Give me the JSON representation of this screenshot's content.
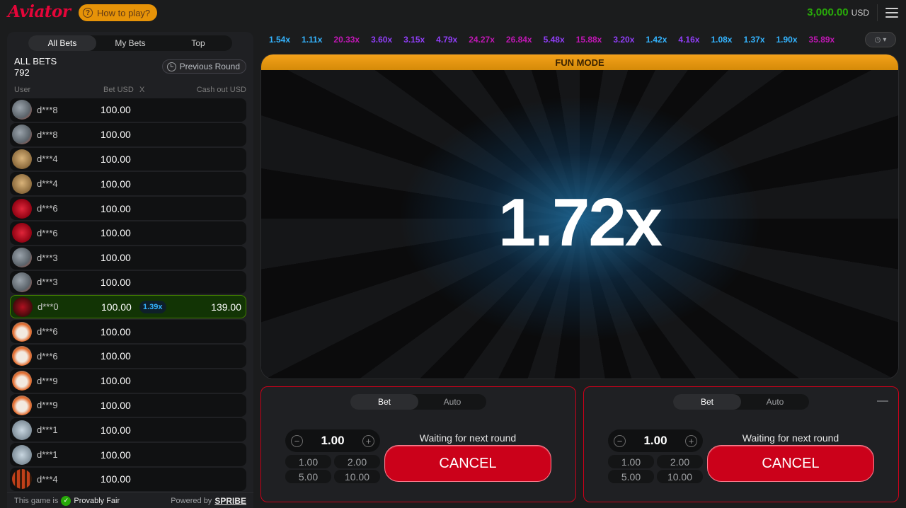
{
  "header": {
    "logo": "Aviator",
    "how_to_play": "How to play?",
    "balance": "3,000.00",
    "currency": "USD"
  },
  "bets_panel": {
    "tabs": [
      "All Bets",
      "My Bets",
      "Top"
    ],
    "active_tab": "All Bets",
    "title": "ALL BETS",
    "count": "792",
    "previous_round": "Previous Round",
    "columns": {
      "user": "User",
      "bet": "Bet USD",
      "x": "X",
      "cashout": "Cash out USD"
    },
    "rows": [
      {
        "user": "d***8",
        "bet": "100.00",
        "mult": "",
        "cashout": "",
        "avatar": "robot",
        "win": false
      },
      {
        "user": "d***8",
        "bet": "100.00",
        "mult": "",
        "cashout": "",
        "avatar": "robot",
        "win": false
      },
      {
        "user": "d***4",
        "bet": "100.00",
        "mult": "",
        "cashout": "",
        "avatar": "lion",
        "win": false
      },
      {
        "user": "d***4",
        "bet": "100.00",
        "mult": "",
        "cashout": "",
        "avatar": "lion",
        "win": false
      },
      {
        "user": "d***6",
        "bet": "100.00",
        "mult": "",
        "cashout": "",
        "avatar": "dice",
        "win": false
      },
      {
        "user": "d***6",
        "bet": "100.00",
        "mult": "",
        "cashout": "",
        "avatar": "dice",
        "win": false
      },
      {
        "user": "d***3",
        "bet": "100.00",
        "mult": "",
        "cashout": "",
        "avatar": "robot",
        "win": false
      },
      {
        "user": "d***3",
        "bet": "100.00",
        "mult": "",
        "cashout": "",
        "avatar": "robot",
        "win": false
      },
      {
        "user": "d***0",
        "bet": "100.00",
        "mult": "1.39x",
        "cashout": "139.00",
        "avatar": "car",
        "win": true
      },
      {
        "user": "d***6",
        "bet": "100.00",
        "mult": "",
        "cashout": "",
        "avatar": "penguin",
        "win": false
      },
      {
        "user": "d***6",
        "bet": "100.00",
        "mult": "",
        "cashout": "",
        "avatar": "penguin",
        "win": false
      },
      {
        "user": "d***9",
        "bet": "100.00",
        "mult": "",
        "cashout": "",
        "avatar": "penguin",
        "win": false
      },
      {
        "user": "d***9",
        "bet": "100.00",
        "mult": "",
        "cashout": "",
        "avatar": "penguin",
        "win": false
      },
      {
        "user": "d***1",
        "bet": "100.00",
        "mult": "",
        "cashout": "",
        "avatar": "money",
        "win": false
      },
      {
        "user": "d***1",
        "bet": "100.00",
        "mult": "",
        "cashout": "",
        "avatar": "money",
        "win": false
      },
      {
        "user": "d***4",
        "bet": "100.00",
        "mult": "",
        "cashout": "",
        "avatar": "flame",
        "win": false
      }
    ],
    "footer": {
      "game_is": "This game is",
      "provably_fair": "Provably Fair",
      "powered_by": "Powered by",
      "brand": "SPRIBE"
    }
  },
  "history": [
    {
      "value": "1.54x",
      "tone": "blue"
    },
    {
      "value": "1.11x",
      "tone": "blue"
    },
    {
      "value": "20.33x",
      "tone": "pink"
    },
    {
      "value": "3.60x",
      "tone": "purple"
    },
    {
      "value": "3.15x",
      "tone": "purple"
    },
    {
      "value": "4.79x",
      "tone": "purple"
    },
    {
      "value": "24.27x",
      "tone": "pink"
    },
    {
      "value": "26.84x",
      "tone": "pink"
    },
    {
      "value": "5.48x",
      "tone": "purple"
    },
    {
      "value": "15.88x",
      "tone": "pink"
    },
    {
      "value": "3.20x",
      "tone": "purple"
    },
    {
      "value": "1.42x",
      "tone": "blue"
    },
    {
      "value": "4.16x",
      "tone": "purple"
    },
    {
      "value": "1.08x",
      "tone": "blue"
    },
    {
      "value": "1.37x",
      "tone": "blue"
    },
    {
      "value": "1.90x",
      "tone": "blue"
    },
    {
      "value": "35.89x",
      "tone": "pink"
    }
  ],
  "game": {
    "mode_banner": "FUN MODE",
    "multiplier": "1.72x"
  },
  "bet_panels": [
    {
      "tabs": [
        "Bet",
        "Auto"
      ],
      "amount": "1.00",
      "quick": [
        "1.00",
        "2.00",
        "5.00",
        "10.00"
      ],
      "status": "Waiting for next round",
      "action": "CANCEL"
    },
    {
      "tabs": [
        "Bet",
        "Auto"
      ],
      "amount": "1.00",
      "quick": [
        "1.00",
        "2.00",
        "5.00",
        "10.00"
      ],
      "status": "Waiting for next round",
      "action": "CANCEL"
    }
  ],
  "colors": {
    "brand_red": "#e50539",
    "balance_green": "#28a909",
    "fun_mode_orange": "#e69308",
    "win_green": "#123405",
    "blue": "#34b4ff",
    "purple": "#913ef8",
    "pink": "#c017b4"
  }
}
